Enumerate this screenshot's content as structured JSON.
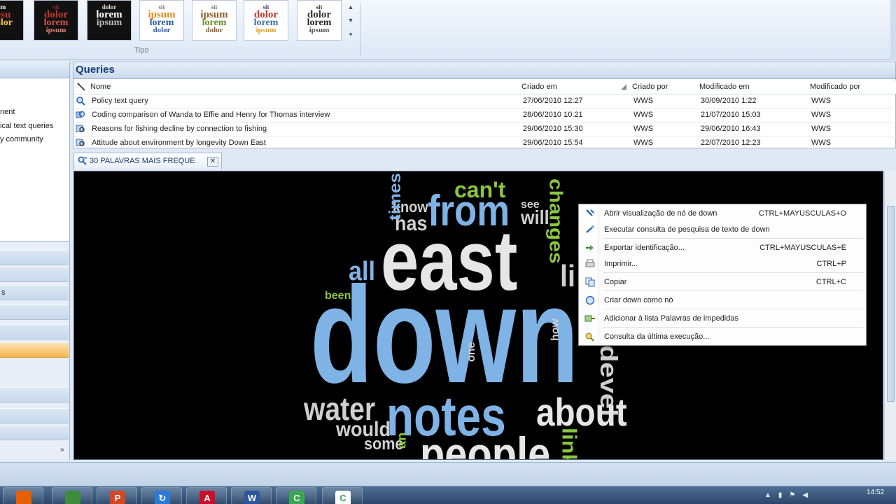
{
  "ribbon": {
    "group_label": "Tipo",
    "gallery": [
      {
        "words": [
          "lim",
          "lpsu",
          "dolor"
        ],
        "colors": [
          "#ffffff",
          "#c0392b",
          "#f5c542"
        ],
        "theme": "dark"
      },
      {
        "words": [
          "sit",
          "dolor",
          "lorem",
          "ipsum"
        ],
        "colors": [
          "#8e2b2b",
          "#c0392b",
          "#d35454",
          "#e08070"
        ],
        "theme": "dark"
      },
      {
        "words": [
          "dolor",
          "lorem",
          "ipsum"
        ],
        "colors": [
          "#dddddd",
          "#ffffff",
          "#bbbbbb"
        ],
        "theme": "dark"
      },
      {
        "words": [
          "sit",
          "ipsum",
          "lorem",
          "dolor"
        ],
        "colors": [
          "#777777",
          "#e08a1e",
          "#2a5caa",
          "#2a5caa"
        ],
        "theme": "light"
      },
      {
        "words": [
          "sit",
          "ipsum",
          "lorem",
          "dolor"
        ],
        "colors": [
          "#777777",
          "#8e5a2b",
          "#6b8e23",
          "#8e5a2b"
        ],
        "theme": "light"
      },
      {
        "words": [
          "sit",
          "dolor",
          "lorem",
          "ipsum"
        ],
        "colors": [
          "#4b3a8e",
          "#c0392b",
          "#3a6ea5",
          "#e0a020"
        ],
        "theme": "light"
      },
      {
        "words": [
          "sit",
          "dolor",
          "lorem",
          "ipsum"
        ],
        "colors": [
          "#333333",
          "#333333",
          "#222222",
          "#555555"
        ],
        "theme": "light"
      }
    ]
  },
  "nav": {
    "tree_items": [
      "nent",
      "ical text queries",
      "y community"
    ],
    "buttons": [
      "s",
      "",
      "",
      "",
      "",
      "",
      "",
      ""
    ],
    "active_button_index": 5
  },
  "queries": {
    "title": "Queries",
    "columns": {
      "name": "Nome",
      "created": "Criado em",
      "created_by": "Criado por",
      "modified": "Modificado em",
      "modified_by": "Modificado por"
    },
    "rows": [
      {
        "name": "Policy text query",
        "created": "27/06/2010 12:27",
        "created_by": "WWS",
        "modified": "30/09/2010 1:22",
        "modified_by": "WWS",
        "icon": "text-search-query-icon"
      },
      {
        "name": "Coding comparison of Wanda to Effie and Henry for Thomas interview",
        "created": "28/06/2010 10:21",
        "created_by": "WWS",
        "modified": "21/07/2010 15:03",
        "modified_by": "WWS",
        "icon": "coding-comparison-query-icon"
      },
      {
        "name": "Reasons for fishing decline by connection to fishing",
        "created": "29/06/2010 15:30",
        "created_by": "WWS",
        "modified": "29/06/2010 16:43",
        "modified_by": "WWS",
        "icon": "matrix-query-icon"
      },
      {
        "name": "Attitude about environment by longevity Down East",
        "created": "29/06/2010 15:54",
        "created_by": "WWS",
        "modified": "22/07/2010 12:23",
        "modified_by": "WWS",
        "icon": "matrix-query-icon"
      }
    ]
  },
  "doc_tab": {
    "label": "30 PALAVRAS MAIS FREQUE",
    "close": "✕"
  },
  "cloud": {
    "words": [
      {
        "text": "can't",
        "color": "#8cc63f"
      },
      {
        "text": "know",
        "color": "#cfcfcf"
      },
      {
        "text": "from",
        "color": "#7fb2e5"
      },
      {
        "text": "see",
        "color": "#cfcfcf"
      },
      {
        "text": "will",
        "color": "#cfcfcf"
      },
      {
        "text": "has",
        "color": "#cfcfcf"
      },
      {
        "text": "times",
        "color": "#7fb2e5"
      },
      {
        "text": "changes",
        "color": "#8cc63f"
      },
      {
        "text": "all",
        "color": "#7fb2e5"
      },
      {
        "text": "east",
        "color": "#e6e6e6"
      },
      {
        "text": "li",
        "color": "#cfcfcf"
      },
      {
        "text": "been",
        "color": "#8cc63f"
      },
      {
        "text": "down",
        "color": "#7fb2e5"
      },
      {
        "text": "how",
        "color": "#cfcfcf"
      },
      {
        "text": "one",
        "color": "#cfcfcf"
      },
      {
        "text": "devel",
        "color": "#cfcfcf"
      },
      {
        "text": "water",
        "color": "#cfcfcf"
      },
      {
        "text": "notes",
        "color": "#7fb2e5"
      },
      {
        "text": "about",
        "color": "#e6e6e6"
      },
      {
        "text": "would",
        "color": "#cfcfcf"
      },
      {
        "text": "link",
        "color": "#8cc63f"
      },
      {
        "text": "some",
        "color": "#cfcfcf"
      },
      {
        "text": "people",
        "color": "#e6e6e6"
      },
      {
        "text": "an",
        "color": "#8cc63f"
      }
    ]
  },
  "context_menu": {
    "items": [
      {
        "label": "Abrir visualização de nó de down",
        "shortcut": "CTRL+MAYUSCULAS+O",
        "icon": "open-node-icon"
      },
      {
        "label": "Executar consulta de pesquisa de texto de down",
        "shortcut": "",
        "icon": "run-text-search-icon"
      },
      {
        "label": "Exportar identificação...",
        "shortcut": "CTRL+MAYUSCULAS+E",
        "icon": "export-icon"
      },
      {
        "label": "Imprimir...",
        "shortcut": "CTRL+P",
        "icon": "print-icon"
      },
      {
        "label": "Copiar",
        "shortcut": "CTRL+C",
        "icon": "copy-icon"
      },
      {
        "label": "Criar down como nó",
        "shortcut": "",
        "icon": "create-node-icon"
      },
      {
        "label": "Adicionar à lista Palavras de impedidas",
        "shortcut": "",
        "icon": "add-stop-word-icon"
      },
      {
        "label": "Consulta da última execução...",
        "shortcut": "",
        "icon": "last-run-query-icon"
      }
    ]
  },
  "taskbar": {
    "apps": [
      {
        "name": "firefox",
        "color": "#e66000",
        "glyph": ""
      },
      {
        "name": "chrome",
        "color": "#3c8c3c",
        "glyph": ""
      },
      {
        "name": "powerpoint",
        "color": "#d24726",
        "glyph": "P"
      },
      {
        "name": "sync",
        "color": "#2a7ad8",
        "glyph": "↻"
      },
      {
        "name": "acrobat",
        "color": "#c8102e",
        "glyph": "A"
      },
      {
        "name": "word",
        "color": "#2b579a",
        "glyph": "W"
      },
      {
        "name": "camtasia",
        "color": "#3aa655",
        "glyph": "C"
      },
      {
        "name": "camtasia-recorder",
        "color": "#ffffff",
        "glyph": "C"
      }
    ],
    "clock": "14:52"
  }
}
